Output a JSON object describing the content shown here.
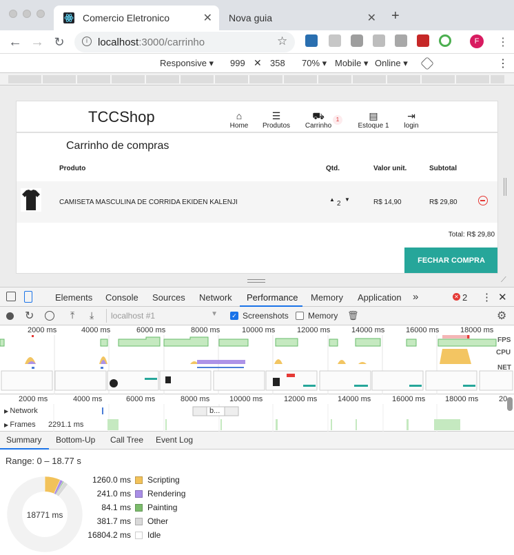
{
  "browser": {
    "tabs": [
      {
        "title": "Comercio Eletronico",
        "active": true
      },
      {
        "title": "Nova guia",
        "active": false
      }
    ],
    "url_host": "localhost",
    "url_path": ":3000/carrinho",
    "profile_initial": "F"
  },
  "device_toolbar": {
    "mode": "Responsive ▾",
    "width": "999",
    "height": "358",
    "zoom": "70% ▾",
    "device_type": "Mobile ▾",
    "network": "Online ▾"
  },
  "shop": {
    "logo": "TCCShop",
    "nav": [
      {
        "label": "Home",
        "icon": "home-icon"
      },
      {
        "label": "Produtos",
        "icon": "list-icon"
      },
      {
        "label": "Carrinho",
        "icon": "cart-icon"
      },
      {
        "label": "Estoque 1",
        "icon": "stock-icon"
      },
      {
        "label": "login",
        "icon": "login-icon"
      }
    ],
    "cart_badge": "1",
    "cart_title": "Carrinho de compras",
    "columns": {
      "product": "Produto",
      "qty": "Qtd.",
      "unit": "Valor unit.",
      "subtotal": "Subtotal"
    },
    "item": {
      "name": "CAMISETA MASCULINA DE CORRIDA EKIDEN KALENJI",
      "qty": "2",
      "unit_price": "R$ 14,90",
      "subtotal": "R$ 29,80"
    },
    "total": "Total: R$ 29,80",
    "checkout_label": "FECHAR COMPRA",
    "accent": "#26a69a"
  },
  "devtools": {
    "tabs": [
      "Elements",
      "Console",
      "Sources",
      "Network",
      "Performance",
      "Memory",
      "Application"
    ],
    "active_tab": "Performance",
    "more_tabs": "»",
    "error_count": "2",
    "recording_select": "localhost #1",
    "screenshots_label": "Screenshots",
    "screenshots_checked": true,
    "memory_label": "Memory",
    "memory_checked": false,
    "overview_ticks": [
      "2000 ms",
      "4000 ms",
      "6000 ms",
      "8000 ms",
      "10000 ms",
      "12000 ms",
      "14000 ms",
      "16000 ms",
      "18000 ms"
    ],
    "overview_labels": {
      "fps": "FPS",
      "cpu": "CPU",
      "net": "NET"
    },
    "timeline_ticks": [
      "2000 ms",
      "4000 ms",
      "6000 ms",
      "8000 ms",
      "10000 ms",
      "12000 ms",
      "14000 ms",
      "16000 ms",
      "18000 ms",
      "20"
    ],
    "tracks": {
      "network": "Network",
      "frames": "Frames",
      "frames_value": "2291.1 ms",
      "network_chip": "b..."
    },
    "bottom_tabs": [
      "Summary",
      "Bottom-Up",
      "Call Tree",
      "Event Log"
    ],
    "range": "Range: 0 – 18.77 s",
    "total_time": "18771 ms",
    "summary": [
      {
        "value": "1260.0 ms",
        "label": "Scripting",
        "color": "#f2c25a",
        "ms": 1260.0
      },
      {
        "value": "241.0 ms",
        "label": "Rendering",
        "color": "#a98ee6",
        "ms": 241.0
      },
      {
        "value": "84.1 ms",
        "label": "Painting",
        "color": "#7cbc6c",
        "ms": 84.1
      },
      {
        "value": "381.7 ms",
        "label": "Other",
        "color": "#d9d9d9",
        "ms": 381.7
      },
      {
        "value": "16804.2 ms",
        "label": "Idle",
        "color": "#ffffff",
        "ms": 16804.2
      }
    ]
  }
}
